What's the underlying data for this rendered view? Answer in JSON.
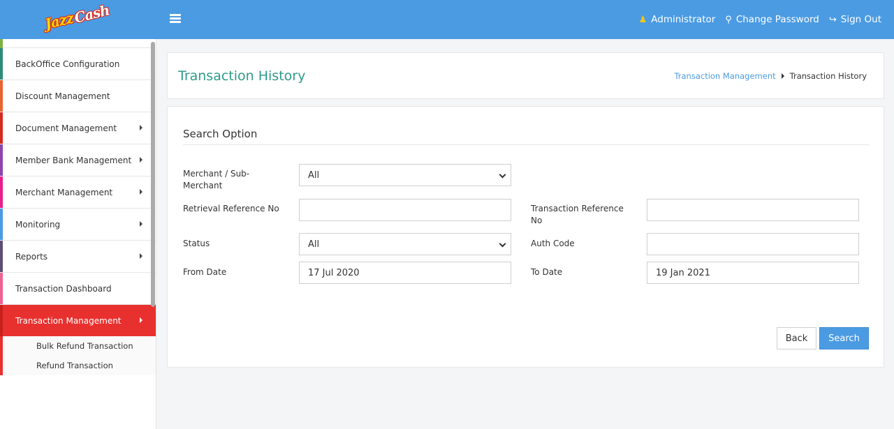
{
  "brand": {
    "logo_jazz": "Jazz",
    "logo_cash": "Cash"
  },
  "topbar": {
    "menu_icon": "bars-icon",
    "user": {
      "icon": "user-icon",
      "label": "Administrator"
    },
    "change_password": {
      "icon": "key-icon",
      "label": "Change Password"
    },
    "sign_out": {
      "icon": "sign-out-icon",
      "label": "Sign Out"
    }
  },
  "sidebar": {
    "items": [
      {
        "label": "BackOffice Configuration",
        "has_submenu": false,
        "stripe": "#2e8b7a"
      },
      {
        "label": "Discount Management",
        "has_submenu": false,
        "stripe": "#e8632f"
      },
      {
        "label": "Document Management",
        "has_submenu": true,
        "stripe": "#d52a1e"
      },
      {
        "label": "Member Bank Management",
        "has_submenu": true,
        "stripe": "#8e44ad"
      },
      {
        "label": "Merchant Management",
        "has_submenu": true,
        "stripe": "#e91e8c"
      },
      {
        "label": "Monitoring",
        "has_submenu": true,
        "stripe": "#4b9be3"
      },
      {
        "label": "Reports",
        "has_submenu": true,
        "stripe": "#5d4e75"
      },
      {
        "label": "Transaction Dashboard",
        "has_submenu": false,
        "stripe": "#f06292"
      },
      {
        "label": "Transaction Management",
        "has_submenu": true,
        "active": true,
        "stripe": "#e8312f"
      }
    ],
    "subitems": [
      {
        "label": "Bulk Refund Transaction"
      },
      {
        "label": "Refund Transaction"
      }
    ]
  },
  "header": {
    "title": "Transaction History",
    "breadcrumb": {
      "parent": "Transaction Management",
      "current": "Transaction History"
    }
  },
  "search": {
    "section_title": "Search Option",
    "merchant": {
      "label": "Merchant / Sub-Merchant",
      "value": "All"
    },
    "rrn": {
      "label": "Retrieval Reference No",
      "value": ""
    },
    "trn": {
      "label": "Transaction Reference No",
      "value": ""
    },
    "status": {
      "label": "Status",
      "value": "All"
    },
    "auth_code": {
      "label": "Auth Code",
      "value": ""
    },
    "from_date": {
      "label": "From Date",
      "value": "17 Jul 2020"
    },
    "to_date": {
      "label": "To Date",
      "value": "19 Jan 2021"
    },
    "back_label": "Back",
    "search_label": "Search"
  },
  "colors": {
    "topbar": "#4b9be3",
    "title": "#2e9b8b",
    "active": "#e8312f",
    "primary_button": "#4b9be3"
  }
}
